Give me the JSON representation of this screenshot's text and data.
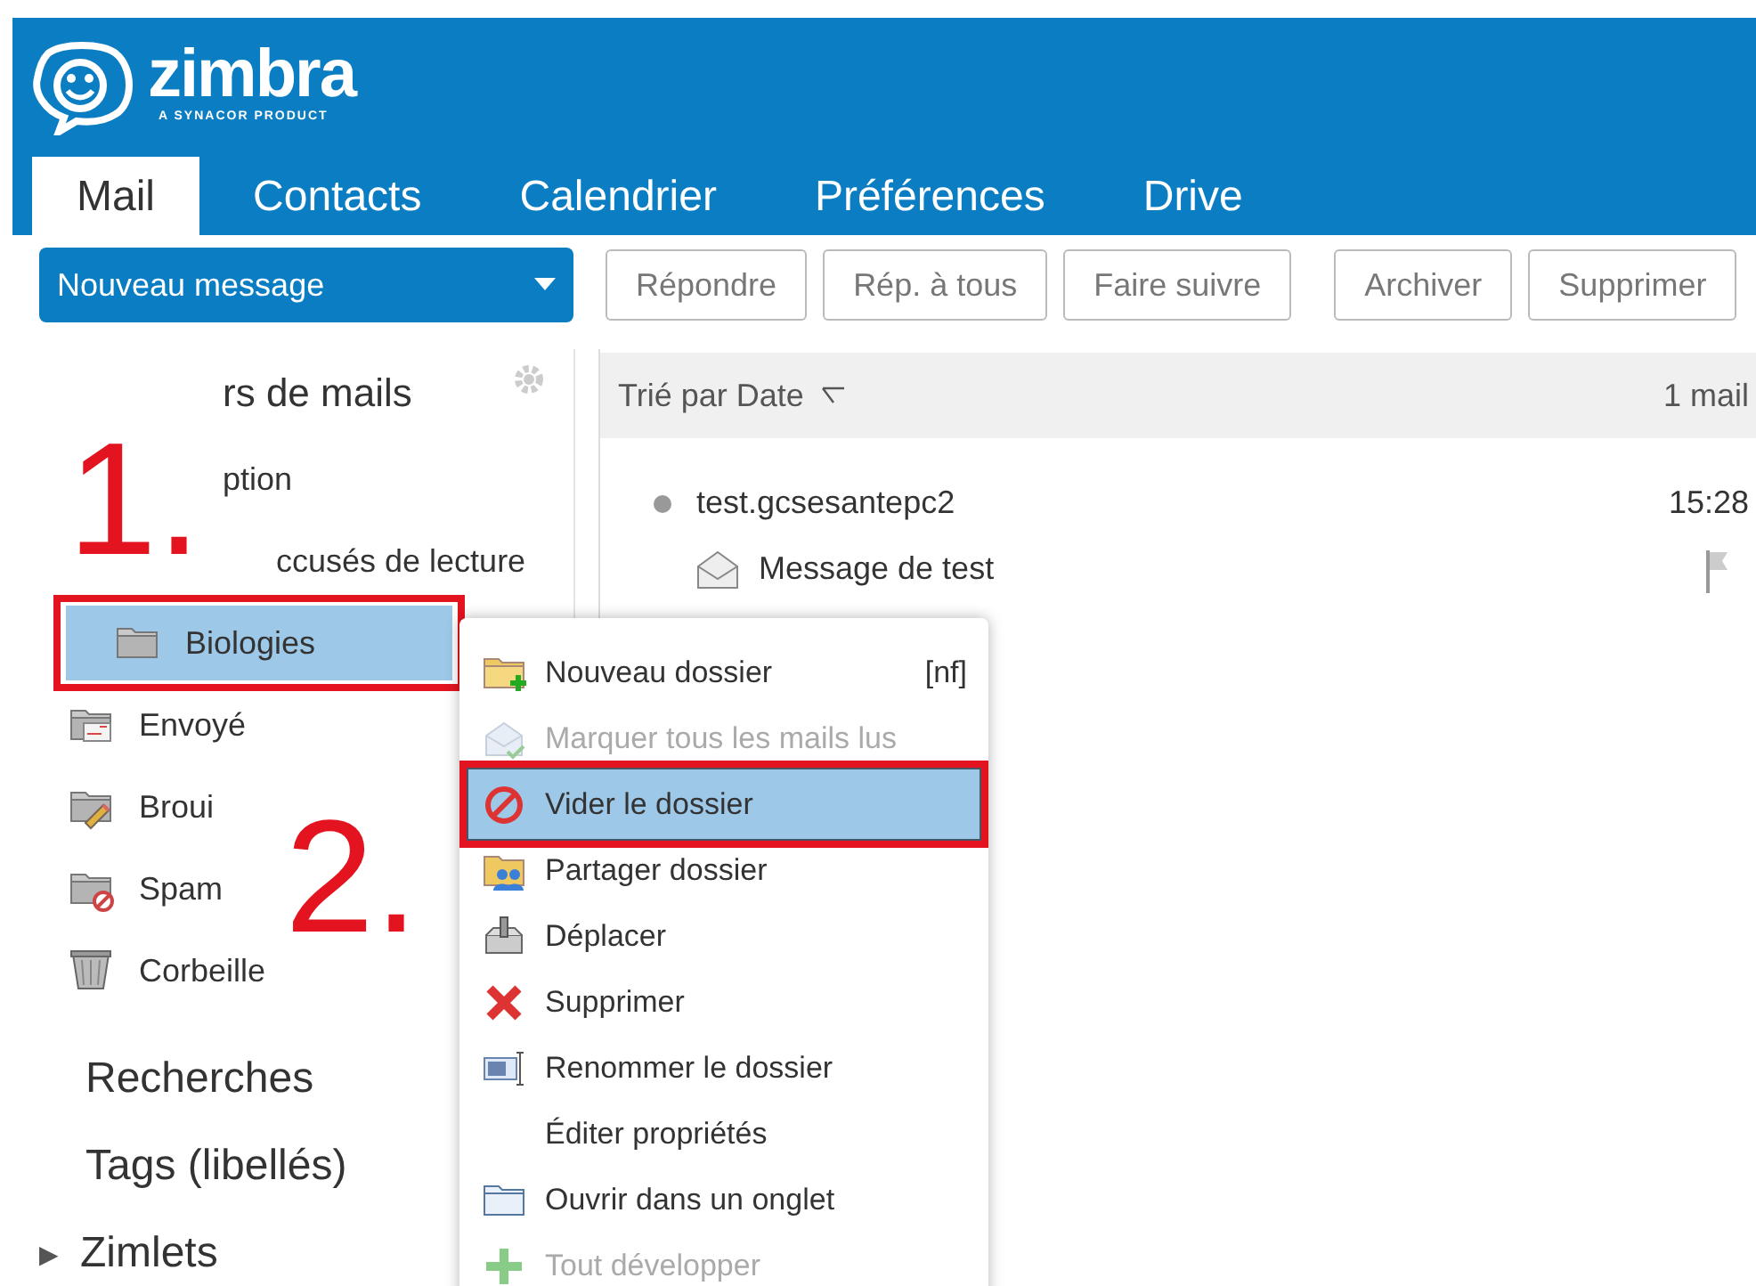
{
  "logo": {
    "name": "zimbra",
    "tagline": "A SYNACOR PRODUCT"
  },
  "tabs": [
    {
      "label": "Mail",
      "selected": true
    },
    {
      "label": "Contacts",
      "selected": false
    },
    {
      "label": "Calendrier",
      "selected": false
    },
    {
      "label": "Préférences",
      "selected": false
    },
    {
      "label": "Drive",
      "selected": false
    }
  ],
  "new_button": {
    "label": "Nouveau message"
  },
  "toolbar": [
    {
      "label": "Répondre"
    },
    {
      "label": "Rép. à tous"
    },
    {
      "label": "Faire suivre"
    },
    {
      "label": "Archiver"
    },
    {
      "label": "Supprimer"
    }
  ],
  "sidebar": {
    "heading": "rs de mails",
    "folders": [
      {
        "label": "ption",
        "selected": false,
        "highlighted": false,
        "children": [
          {
            "label": "ccusés de lecture",
            "selected": false,
            "highlighted": false
          },
          {
            "label": "Biologies",
            "kind": "folder",
            "selected": true,
            "highlighted": true
          }
        ]
      },
      {
        "label": "Envoyé",
        "kind": "sent",
        "selected": false,
        "highlighted": false
      },
      {
        "label": "Broui",
        "kind": "draft",
        "selected": false,
        "highlighted": false
      },
      {
        "label": "Spam",
        "kind": "spam",
        "selected": false,
        "highlighted": false
      },
      {
        "label": "Corbeille",
        "kind": "trash",
        "selected": false,
        "highlighted": false
      }
    ],
    "sections": [
      {
        "label": "Recherches"
      },
      {
        "label": "Tags (libellés)"
      },
      {
        "label": "Zimlets",
        "expander": "▶"
      }
    ]
  },
  "message_list": {
    "sort_label": "Trié par Date",
    "count": "1 mail",
    "messages": [
      {
        "sender": "test.gcsesantepc2",
        "time": "15:28",
        "subject": "Message de test",
        "read": true
      }
    ]
  },
  "context_menu": [
    {
      "label": "Nouveau dossier",
      "kind": "create",
      "shortcut": "[nf]",
      "disabled": false,
      "selected": false,
      "highlighted": false
    },
    {
      "label": "Marquer tous les mails lus",
      "kind": "markread",
      "disabled": true,
      "selected": false,
      "highlighted": false
    },
    {
      "label": "Vider le dossier",
      "kind": "empty",
      "disabled": false,
      "selected": true,
      "highlighted": true
    },
    {
      "label": "Partager dossier",
      "kind": "share",
      "disabled": false,
      "selected": false,
      "highlighted": false
    },
    {
      "label": "Déplacer",
      "kind": "move",
      "disabled": false,
      "selected": false,
      "highlighted": false
    },
    {
      "label": "Supprimer",
      "kind": "delete",
      "disabled": false,
      "selected": false,
      "highlighted": false
    },
    {
      "label": "Renommer le dossier",
      "kind": "rename",
      "disabled": false,
      "selected": false,
      "highlighted": false
    },
    {
      "label": "Éditer propriétés",
      "kind": "none",
      "disabled": false,
      "selected": false,
      "highlighted": false
    },
    {
      "label": "Ouvrir dans un onglet",
      "kind": "open",
      "disabled": false,
      "selected": false,
      "highlighted": false
    },
    {
      "label": "Tout développer",
      "kind": "expand",
      "disabled": true,
      "selected": false,
      "highlighted": false
    }
  ],
  "annotations": [
    {
      "text": "1."
    },
    {
      "text": "2."
    }
  ]
}
